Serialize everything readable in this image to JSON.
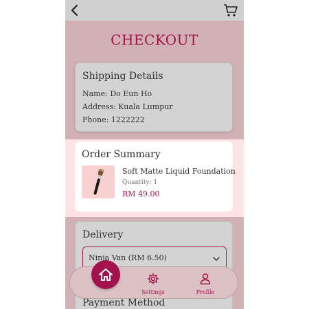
{
  "header": {
    "title": "CHECKOUT"
  },
  "icons": {
    "back": "back-arrow-icon",
    "cart": "shopping-cart-icon",
    "home": "home-icon",
    "settings": "gear-icon",
    "profile": "person-icon"
  },
  "shipping": {
    "title": "Shipping Details",
    "name": "Name: Do Eun Ho",
    "address": "Address: Kuala Lumpur",
    "phone": "Phone: 1222222"
  },
  "order_summary": {
    "title": "Order Summary",
    "product_name": "Soft Matte Liquid Foundation",
    "quantity": "Quantity: 1",
    "price": "RM 49.00"
  },
  "delivery": {
    "title": "Delivery",
    "selected": "Ninja Van (RM 6.50)"
  },
  "payment": {
    "title": "Payment Method"
  },
  "nav": {
    "settings_label": "Settings",
    "profile_label": "Profile"
  },
  "colors": {
    "accent": "#a4124e",
    "background": "#d2b1b5",
    "card": "#d3d3d3",
    "highlight": "#fde3e3"
  }
}
